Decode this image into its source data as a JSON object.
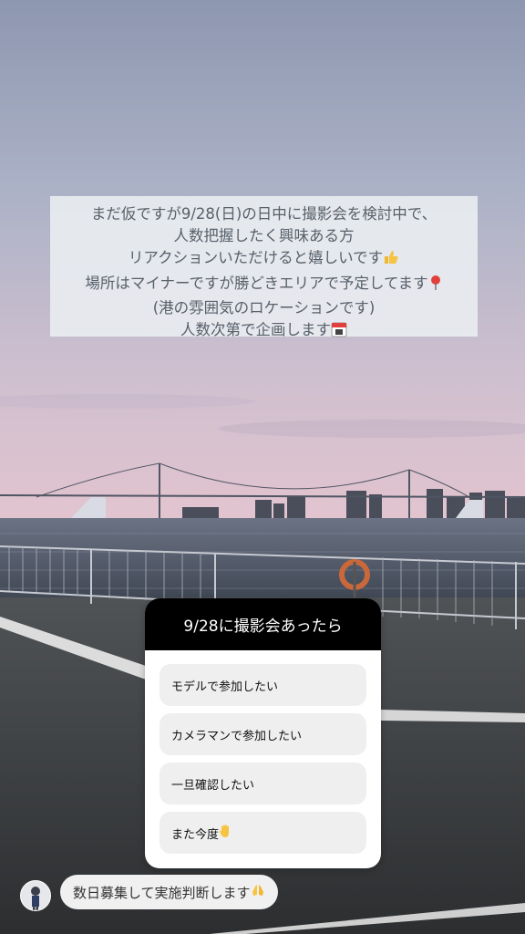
{
  "story": {
    "caption_lines": [
      "まだ仮ですが9/28(日)の日中に撮影会を検討中で、",
      "人数把握したく興味ある方",
      "リアクションいただけると嬉しいです",
      "場所はマイナーですが勝どきエリアで予定してます",
      "(港の雰囲気のロケーションです)",
      "人数次第で企画します"
    ],
    "poll": {
      "question": "9/28に撮影会あったら",
      "options": [
        "モデルで参加したい",
        "カメラマンで参加したい",
        "一旦確認したい",
        "また今度"
      ]
    },
    "reply": {
      "text": "数日募集して実施判断します"
    }
  },
  "colors": {
    "sky_top": "#9ea6bd",
    "sky_bottom": "#d9c0cc",
    "water": "#4f5868",
    "pavement": "#3b3d40",
    "poll_header_bg": "#000000",
    "option_bg": "#efefef"
  },
  "icons": [
    "thumbs-up-icon",
    "pin-icon",
    "calendar-icon",
    "raised-hand-icon",
    "pray-icon",
    "avatar"
  ]
}
